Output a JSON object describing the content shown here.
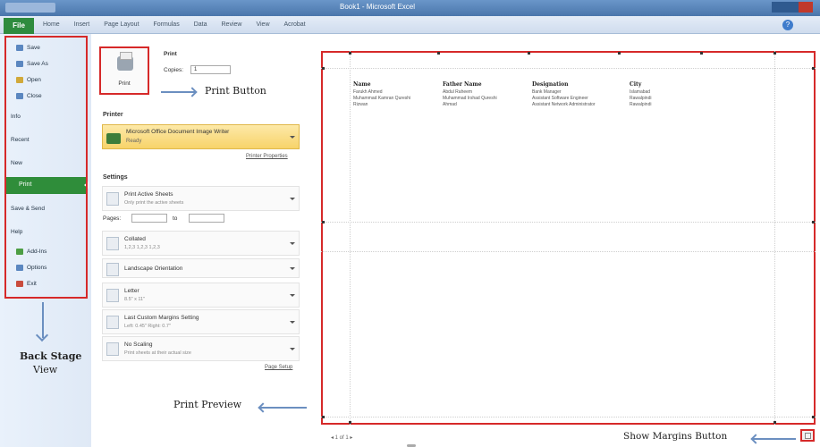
{
  "window": {
    "title": "Book1 - Microsoft Excel"
  },
  "ribbon": {
    "file_tab": "File",
    "tabs": [
      "Home",
      "Insert",
      "Page Layout",
      "Formulas",
      "Data",
      "Review",
      "View",
      "Acrobat"
    ],
    "help_icon": "?"
  },
  "backstage": {
    "items": [
      {
        "label": "Save",
        "icon": "save-icon"
      },
      {
        "label": "Save As",
        "icon": "save-as-icon"
      },
      {
        "label": "Open",
        "icon": "open-icon"
      },
      {
        "label": "Close",
        "icon": "close-icon"
      },
      {
        "label": "Info"
      },
      {
        "label": "Recent"
      },
      {
        "label": "New"
      },
      {
        "label": "Print",
        "selected": true
      },
      {
        "label": "Save & Send"
      },
      {
        "label": "Help"
      },
      {
        "label": "Add-Ins",
        "icon": "add-ins-icon"
      },
      {
        "label": "Options",
        "icon": "options-icon"
      },
      {
        "label": "Exit",
        "icon": "exit-icon"
      }
    ]
  },
  "print": {
    "heading": "Print",
    "button_label": "Print",
    "copies_label": "Copies:",
    "copies_value": "1",
    "printer_header": "Printer",
    "printer_name": "Microsoft Office Document Image Writer",
    "printer_status": "Ready",
    "printer_properties": "Printer Properties",
    "settings_header": "Settings",
    "settings": [
      {
        "line1": "Print Active Sheets",
        "line2": "Only print the active sheets"
      },
      {
        "line1": "Collated",
        "line2": "1,2,3   1,2,3   1,2,3"
      },
      {
        "line1": "Landscape Orientation",
        "line2": ""
      },
      {
        "line1": "Letter",
        "line2": "8.5\" x 11\""
      },
      {
        "line1": "Last Custom Margins Setting",
        "line2": "Left: 0.45\"   Right: 0.7\""
      },
      {
        "line1": "No Scaling",
        "line2": "Print sheets at their actual size"
      }
    ],
    "pages_label": "Pages:",
    "to_label": "to",
    "page_setup": "Page Setup"
  },
  "preview": {
    "columns": [
      "Name",
      "Father Name",
      "Designation",
      "City"
    ],
    "rows": [
      [
        "Farukh Ahmed",
        "Abdul Raheem",
        "Bank Manager",
        "Islamabad"
      ],
      [
        "Muhammad Kamran Qureshi",
        "Muhammad Irshad Qureshi",
        "Assistant Software Engineer",
        "Rawalpindi"
      ],
      [
        "Rizwan",
        "Ahmad",
        "Assistant Network Administrator",
        "Rawalpindi"
      ]
    ],
    "page_nav": "◂  1   of 1  ▸"
  },
  "annotations": {
    "print_button": "Print Button",
    "back_stage_line1": "Back Stage",
    "back_stage_line2": "View",
    "print_preview": "Print Preview",
    "show_margins": "Show Margins Button"
  },
  "colors": {
    "highlight": "#d62929",
    "file_green": "#2e8b3e",
    "arrow": "#6b8fc0"
  }
}
